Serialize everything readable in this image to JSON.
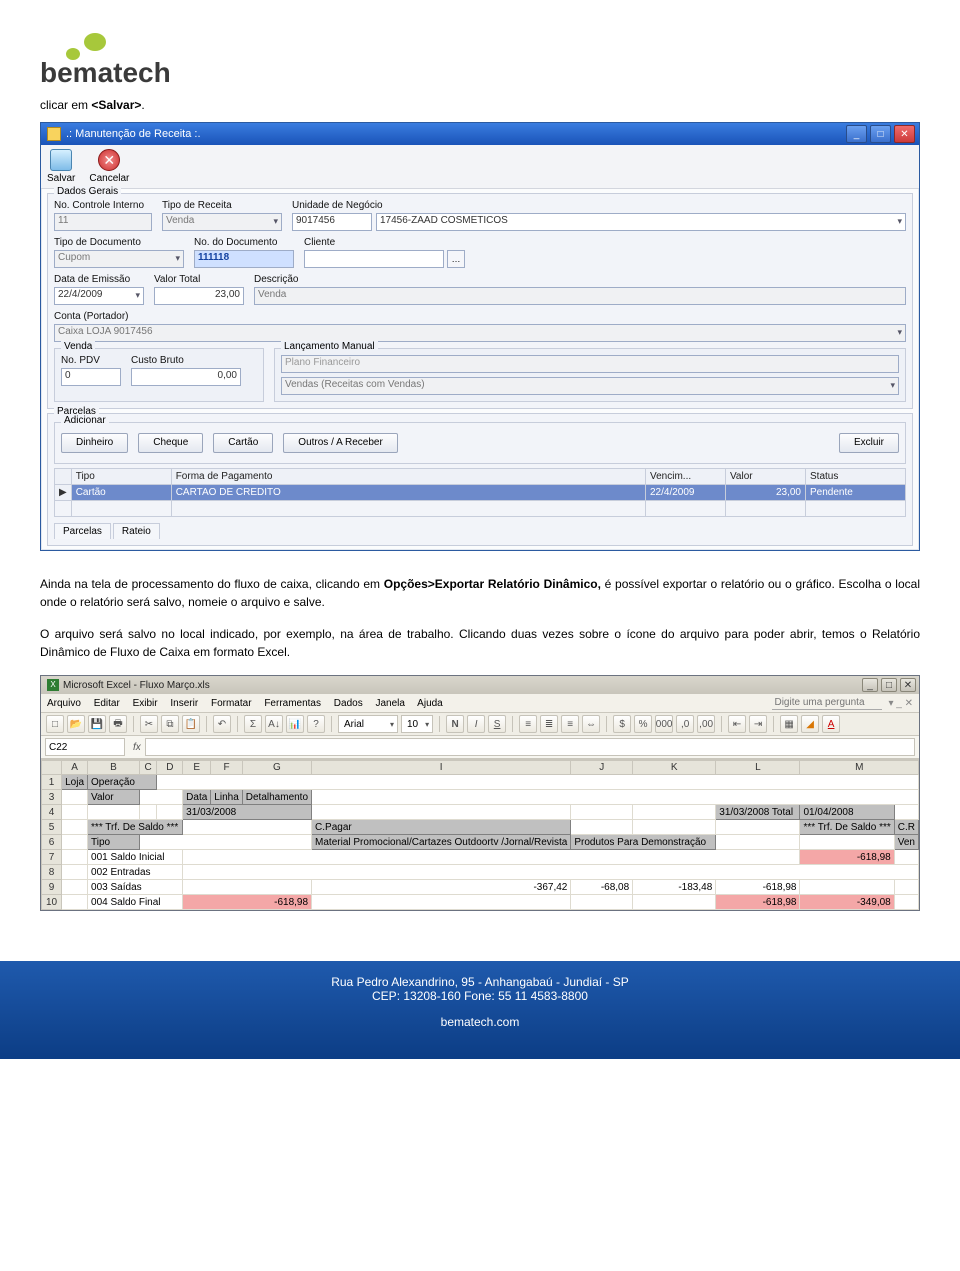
{
  "intro": {
    "pre": "clicar em ",
    "bold": "<Salvar>",
    "post": "."
  },
  "win1": {
    "title": ".: Manutenção de Receita :.",
    "toolbar": {
      "save": "Salvar",
      "cancel": "Cancelar"
    },
    "fs_dados": "Dados Gerais",
    "labels": {
      "no_ctl": "No. Controle Interno",
      "tipo_receita": "Tipo de Receita",
      "unidade": "Unidade de Negócio",
      "tipo_doc": "Tipo de Documento",
      "no_doc": "No. do Documento",
      "cliente": "Cliente",
      "data_em": "Data de Emissão",
      "valor_total": "Valor Total",
      "descricao": "Descrição",
      "conta": "Conta (Portador)",
      "venda": "Venda",
      "no_pdv": "No. PDV",
      "custo_bruto": "Custo Bruto",
      "lanc": "Lançamento Manual",
      "plano": "Plano Financeiro",
      "parcelas": "Parcelas",
      "adicionar": "Adicionar"
    },
    "values": {
      "no_ctl": "11",
      "tipo_receita": "Venda",
      "unidade_cod": "9017456",
      "unidade_nome": "17456-ZAAD COSMETICOS",
      "tipo_doc": "Cupom",
      "no_doc": "111118",
      "cliente": "",
      "data_em": "22/4/2009",
      "valor_total": "23,00",
      "descricao": "Venda",
      "conta": "Caixa LOJA 9017456",
      "no_pdv": "0",
      "custo_bruto": "0,00",
      "plano": "Vendas (Receitas com Vendas)"
    },
    "payment_buttons": [
      "Dinheiro",
      "Cheque",
      "Cartão",
      "Outros / A Receber"
    ],
    "excluir": "Excluir",
    "grid": {
      "headers": [
        "Tipo",
        "Forma de Pagamento",
        "Vencim...",
        "Valor",
        "Status"
      ],
      "row": [
        "Cartão",
        "CARTAO DE CREDITO",
        "22/4/2009",
        "23,00",
        "Pendente"
      ]
    },
    "tabs": [
      "Parcelas",
      "Rateio"
    ]
  },
  "para1": {
    "t1": "Ainda na tela de processamento do fluxo de caixa, clicando em ",
    "b1": "Opções>Exportar Relatório Dinâmico,",
    "t2": " é possível exportar o relatório ou o gráfico. Escolha o local onde o relatório será salvo, nomeie o arquivo e salve."
  },
  "para2": "O arquivo será salvo no local indicado, por exemplo, na área de trabalho. Clicando duas vezes sobre o ícone do arquivo para poder abrir, temos o Relatório Dinâmico de Fluxo de Caixa em formato Excel.",
  "excel": {
    "title": "Microsoft Excel - Fluxo Março.xls",
    "menus": [
      "Arquivo",
      "Editar",
      "Exibir",
      "Inserir",
      "Formatar",
      "Ferramentas",
      "Dados",
      "Janela",
      "Ajuda"
    ],
    "ask": "Digite uma pergunta",
    "font": "Arial",
    "fontsize": "10",
    "cellref": "C22",
    "cols": [
      "A",
      "B",
      "C",
      "D",
      "E",
      "F",
      "G",
      "I",
      "J",
      "K",
      "L",
      "M"
    ],
    "rownums": [
      "1",
      "3",
      "4",
      "5",
      "6",
      "7",
      "8",
      "9",
      "10"
    ],
    "a1_loja": "Loja",
    "b1_oper": "Operação",
    "b3_valor": "Valor",
    "g3_data": "Data",
    "g3_linha": "Linha",
    "g3_det": "Detalhamento",
    "g4_date": "31/03/2008",
    "l4_total": "31/03/2008 Total",
    "m4_date": "01/04/2008",
    "b5_trf": "*** Trf. De Saldo ***",
    "i5_cpagar": "C.Pagar",
    "m5_trf": "*** Trf. De Saldo ***",
    "m5_cr": "C.R",
    "b6_tipo": "Tipo",
    "i6_mat": "Material Promocional/Cartazes Outdoortv /Jornal/Revista",
    "j6_prod": "Produtos Para Demonstração",
    "m6_ven": "Ven",
    "b7": "001 Saldo Inicial",
    "m7": "-618,98",
    "b8": "002 Entradas",
    "b9": "003 Saídas",
    "i9": "-367,42",
    "j9": "-68,08",
    "k9": "-183,48",
    "l9": "-618,98",
    "b10": "004 Saldo Final",
    "g10": "-618,98",
    "l10": "-618,98",
    "m10": "-349,08"
  },
  "footer": {
    "line1": "Rua Pedro Alexandrino, 95 - Anhangabaú - Jundiaí - SP",
    "line2": "CEP: 13208-160  Fone: 55 11 4583-8800",
    "line3": "bematech.com"
  }
}
